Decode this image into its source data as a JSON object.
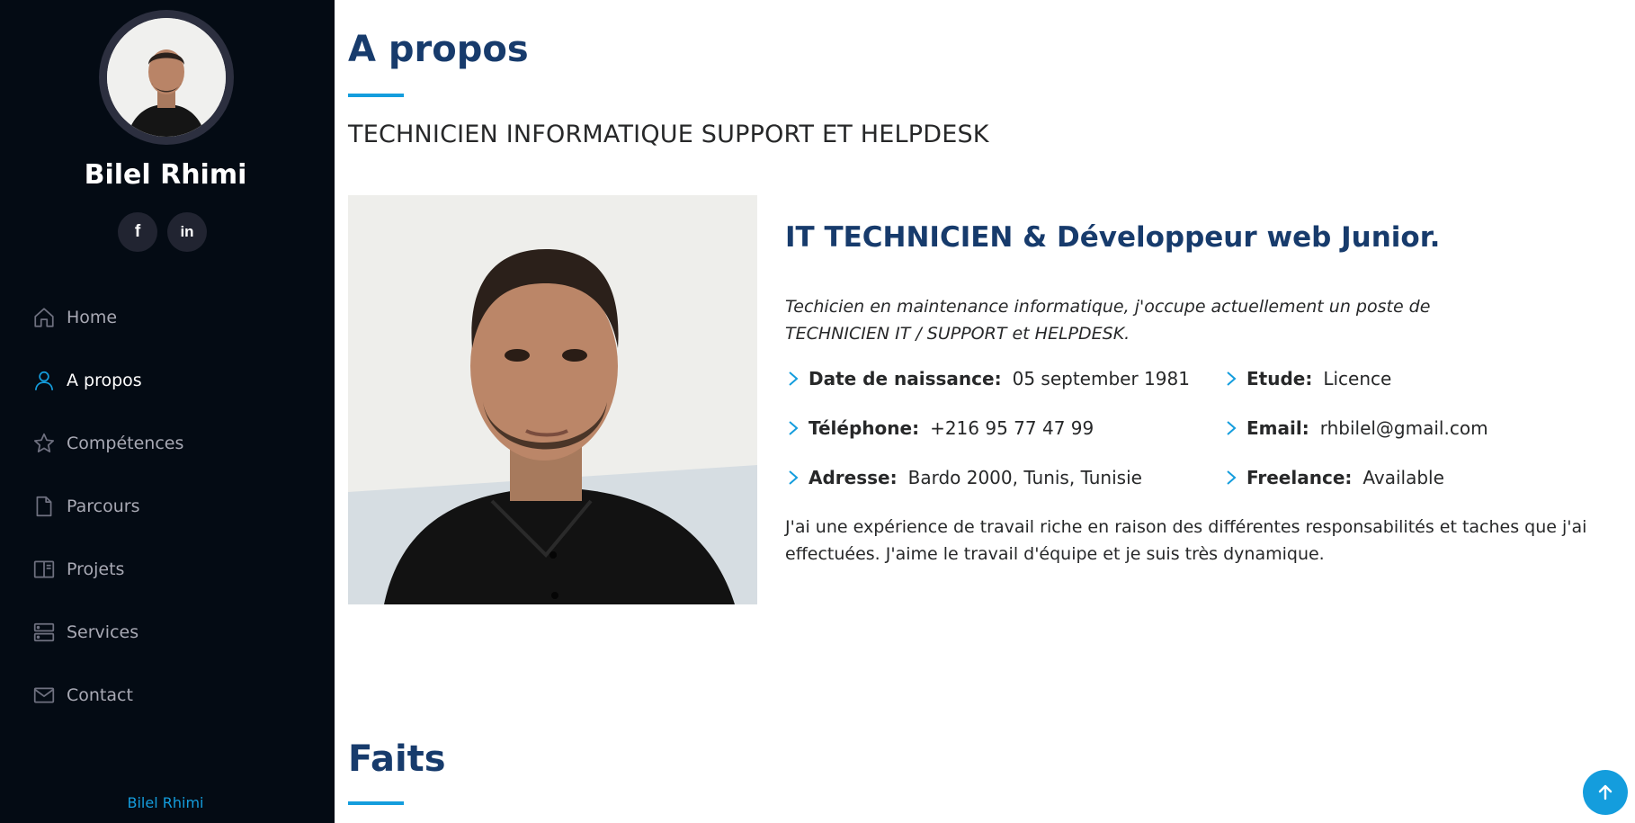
{
  "sidebar": {
    "name": "Bilel Rhimi",
    "social": {
      "facebook": "f",
      "linkedin": "in"
    },
    "nav": [
      {
        "label": "Home",
        "icon": "house-icon"
      },
      {
        "label": "A propos",
        "icon": "person-icon",
        "active": true
      },
      {
        "label": "Compétences",
        "icon": "star-icon"
      },
      {
        "label": "Parcours",
        "icon": "file-icon"
      },
      {
        "label": "Projets",
        "icon": "book-icon"
      },
      {
        "label": "Services",
        "icon": "server-icon"
      },
      {
        "label": "Contact",
        "icon": "envelope-icon"
      }
    ],
    "credit": "Bilel Rhimi"
  },
  "about": {
    "title": "A propos",
    "subtitle": "TECHNICIEN INFORMATIQUE SUPPORT ET HELPDESK",
    "content_title": "IT TECHNICIEN & Développeur web Junior.",
    "intro_line1": "Techicien en maintenance informatique, j'occupe actuellement un poste de",
    "intro_line2": "TECHNICIEN IT / SUPPORT et HELPDESK.",
    "info": {
      "birth": {
        "label": "Date de naissance:",
        "value": "05 september 1981"
      },
      "phone": {
        "label": "Téléphone:",
        "value": "+216 95 77 47 99"
      },
      "address": {
        "label": "Adresse:",
        "value": "Bardo 2000, Tunis, Tunisie"
      },
      "study": {
        "label": "Etude:",
        "value": "Licence"
      },
      "email": {
        "label": "Email:",
        "value": "rhbilel@gmail.com"
      },
      "freelance": {
        "label": "Freelance:",
        "value": "Available"
      }
    },
    "description_line1": "J'ai une expérience de travail riche en raison des différentes responsabilités et taches que j'ai",
    "description_line2": "effectuées. J'aime le travail d'équipe et je suis très dynamique."
  },
  "facts": {
    "title": "Faits"
  },
  "colors": {
    "accent": "#149ddd",
    "heading": "#173b6c",
    "sidebar_bg": "#040b14"
  }
}
